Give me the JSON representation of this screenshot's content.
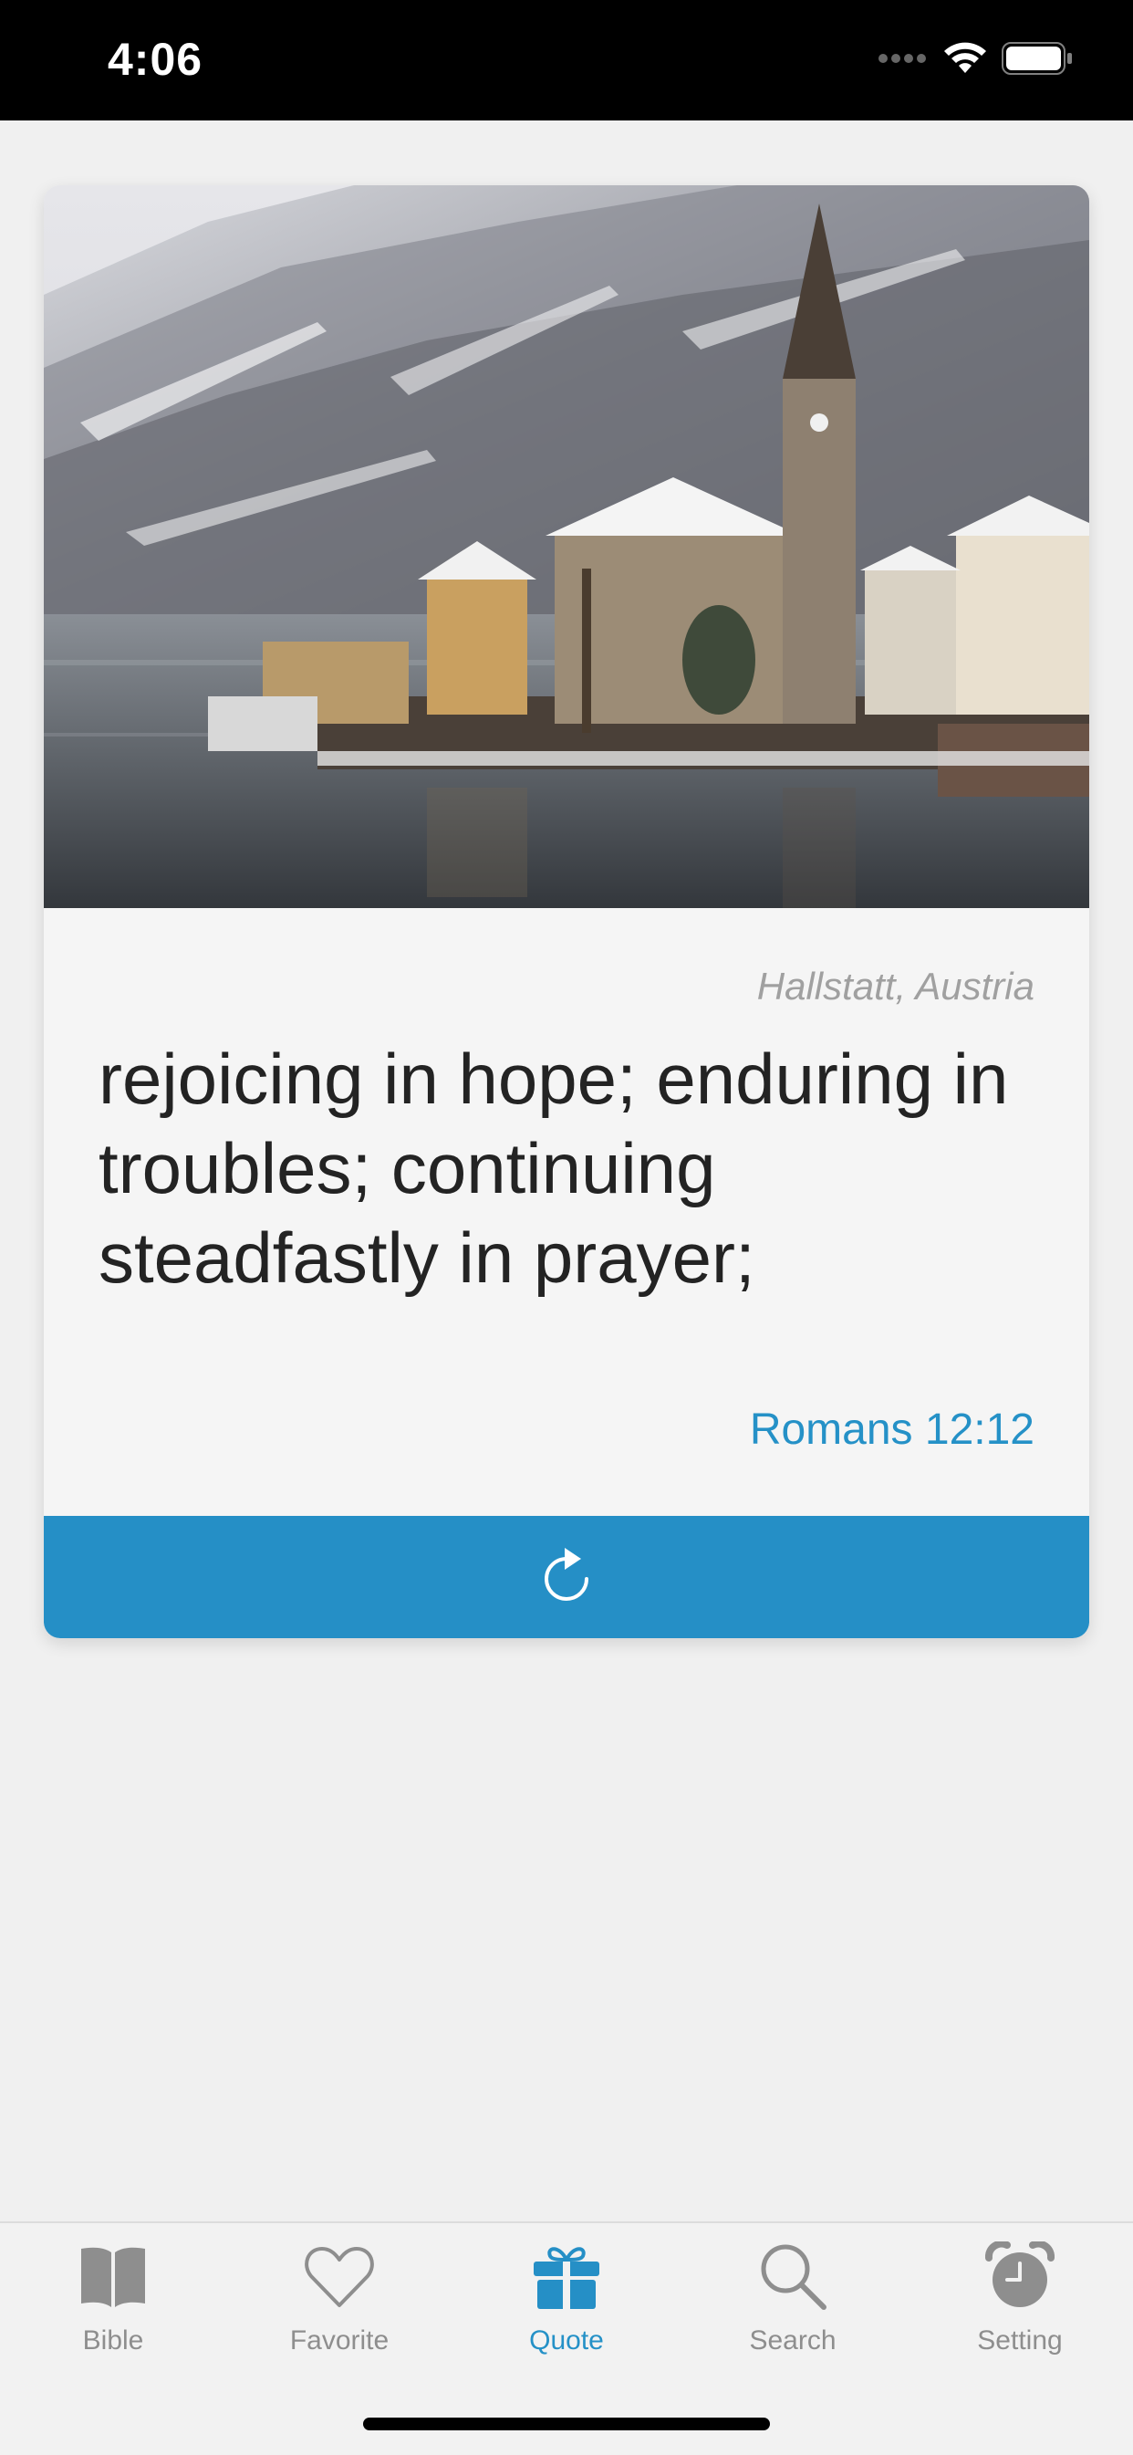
{
  "status_bar": {
    "time": "4:06",
    "icons": [
      "signal-icon",
      "wifi-icon",
      "battery-icon"
    ]
  },
  "quote_card": {
    "photo_icon": "landscape-photo",
    "location": "Hallstatt, Austria",
    "verse": "rejoicing in hope; enduring in troubles; continuing steadfastly in prayer;",
    "reference": "Romans 12:12",
    "refresh_icon": "refresh-icon"
  },
  "tab_bar": {
    "items": [
      {
        "label": "Bible",
        "icon": "book-icon",
        "active": false
      },
      {
        "label": "Favorite",
        "icon": "heart-icon",
        "active": false
      },
      {
        "label": "Quote",
        "icon": "gift-icon",
        "active": true
      },
      {
        "label": "Search",
        "icon": "search-icon",
        "active": false
      },
      {
        "label": "Setting",
        "icon": "alarm-clock-icon",
        "active": false
      }
    ]
  },
  "colors": {
    "accent": "#258fc6",
    "background": "#f0f0f0",
    "verse_text": "#232323",
    "muted": "#8e8e8e"
  }
}
